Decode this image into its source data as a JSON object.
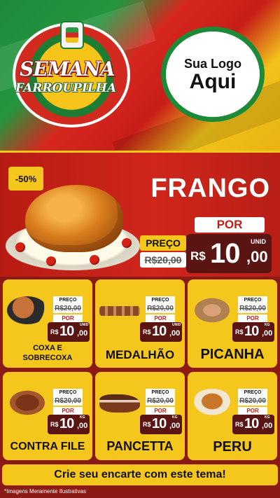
{
  "hero": {
    "title_line1": "SEMANA",
    "title_line2": "FARROUPILHA",
    "logo_line1": "Sua Logo",
    "logo_line2": "Aqui",
    "colors": {
      "green": "#1f8a3a",
      "red": "#d22a1f",
      "yellow": "#f2c21a"
    }
  },
  "featured": {
    "badge": "-50%",
    "name": "FRANGO",
    "por_label": "POR",
    "preco_label": "PREÇO",
    "old_price": "R$20,00",
    "currency": "R$",
    "price_int": "10",
    "price_cents": ",00",
    "unit": "UNID"
  },
  "products": [
    {
      "name_line1": "COXA E",
      "name_line2": "SOBRECOXA",
      "preco_label": "PREÇO",
      "old_price": "R$20,00",
      "por_label": "POR",
      "currency": "R$",
      "price_int": "10",
      "price_cents": ",00",
      "unit": "UNID",
      "icon": "drumstick-pan-icon"
    },
    {
      "name_line1": "MEDALHÃO",
      "name_line2": "",
      "preco_label": "PREÇO",
      "old_price": "R$20,00",
      "por_label": "POR",
      "currency": "R$",
      "price_int": "10",
      "price_cents": ",00",
      "unit": "UNID",
      "icon": "skewers-icon"
    },
    {
      "name_line1": "PICANHA",
      "name_line2": "",
      "preco_label": "PREÇO",
      "old_price": "R$20,00",
      "por_label": "POR",
      "currency": "R$",
      "price_int": "10",
      "price_cents": ",00",
      "unit": "KG",
      "icon": "steak-board-icon"
    },
    {
      "name_line1": "CONTRA FILE",
      "name_line2": "",
      "preco_label": "PREÇO",
      "old_price": "R$20,00",
      "por_label": "POR",
      "currency": "R$",
      "price_int": "10",
      "price_cents": ",00",
      "unit": "KG",
      "icon": "steak-icon"
    },
    {
      "name_line1": "PANCETTA",
      "name_line2": "",
      "preco_label": "PREÇO",
      "old_price": "R$20,00",
      "por_label": "POR",
      "currency": "R$",
      "price_int": "10",
      "price_cents": ",00",
      "unit": "KG",
      "icon": "pancetta-icon"
    },
    {
      "name_line1": "PERU",
      "name_line2": "",
      "preco_label": "PREÇO",
      "old_price": "R$20,00",
      "por_label": "POR",
      "currency": "R$",
      "price_int": "10",
      "price_cents": ",00",
      "unit": "KG",
      "icon": "turkey-icon"
    }
  ],
  "footer": {
    "cta": "Crie seu encarte com este tema!",
    "disclaimer": "*Imagens Meramente Ilustrativas"
  }
}
